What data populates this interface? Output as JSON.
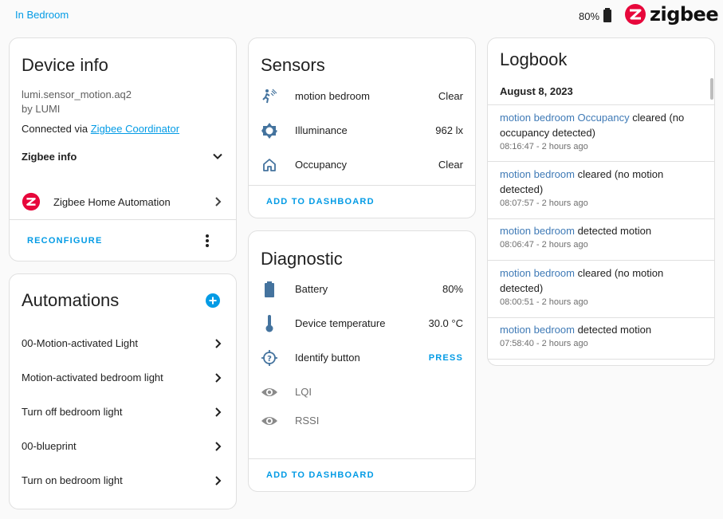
{
  "header": {
    "area_link": "In Bedroom",
    "battery_text": "80%",
    "logo_text": "zigbee"
  },
  "device_info": {
    "title": "Device info",
    "model": "lumi.sensor_motion.aq2",
    "manufacturer": "by LUMI",
    "connected_prefix": "Connected via ",
    "connected_link": "Zigbee Coordinator",
    "zigbee_info_label": "Zigbee info",
    "integration_label": "Zigbee Home Automation",
    "reconfigure_label": "RECONFIGURE"
  },
  "automations": {
    "title": "Automations",
    "items": [
      {
        "label": "00-Motion-activated Light"
      },
      {
        "label": "Motion-activated bedroom light"
      },
      {
        "label": "Turn off bedroom light"
      },
      {
        "label": "00-blueprint"
      },
      {
        "label": "Turn on bedroom light"
      }
    ]
  },
  "sensors": {
    "title": "Sensors",
    "items": [
      {
        "icon": "motion-sensor-icon",
        "label": "motion bedroom",
        "value": "Clear"
      },
      {
        "icon": "brightness-icon",
        "label": "Illuminance",
        "value": "962 lx"
      },
      {
        "icon": "home-outline-icon",
        "label": "Occupancy",
        "value": "Clear"
      }
    ],
    "add_label": "ADD TO DASHBOARD"
  },
  "diagnostic": {
    "title": "Diagnostic",
    "items": [
      {
        "icon": "battery-icon",
        "label": "Battery",
        "value": "80%"
      },
      {
        "icon": "thermometer-icon",
        "label": "Device temperature",
        "value": "30.0 °C"
      },
      {
        "icon": "identify-icon",
        "label": "Identify button",
        "value": "PRESS"
      },
      {
        "icon": "eye-icon",
        "label": "LQI",
        "value": ""
      },
      {
        "icon": "eye-icon",
        "label": "RSSI",
        "value": ""
      }
    ],
    "add_label": "ADD TO DASHBOARD"
  },
  "logbook": {
    "title": "Logbook",
    "date": "August 8, 2023",
    "entries": [
      {
        "entity": "motion bedroom Occupancy",
        "text": " cleared (no occupancy detected)",
        "time": "08:16:47 - 2 hours ago"
      },
      {
        "entity": "motion bedroom",
        "text": " cleared (no motion detected)",
        "time": "08:07:57 - 2 hours ago"
      },
      {
        "entity": "motion bedroom",
        "text": " detected motion",
        "time": "08:06:47 - 2 hours ago"
      },
      {
        "entity": "motion bedroom",
        "text": " cleared (no motion detected)",
        "time": "08:00:51 - 2 hours ago"
      },
      {
        "entity": "motion bedroom",
        "text": " detected motion",
        "time": "07:58:40 - 2 hours ago"
      }
    ]
  },
  "colors": {
    "accent": "#039be5",
    "icon": "#44739e",
    "logbook_link": "#3f7ab6",
    "zigbee_red": "#e7073b"
  }
}
